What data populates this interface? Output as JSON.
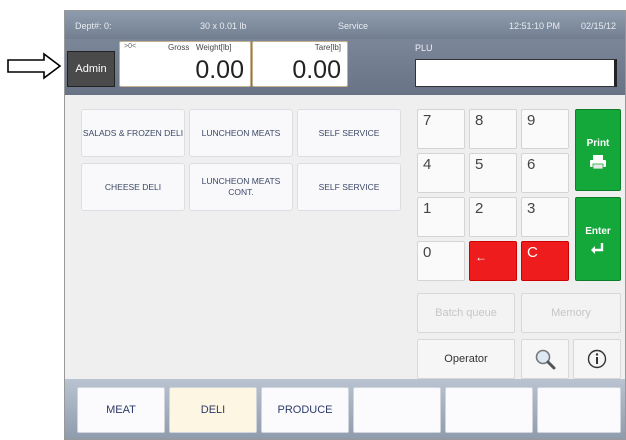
{
  "topbar": {
    "dept": "Dept#: 0:",
    "scale_spec": "30 x 0.01 lb",
    "mode": "Service",
    "time": "12:51:10 PM",
    "date": "02/15/12"
  },
  "header": {
    "admin_label": "Admin",
    "zero_indicator": ">0<",
    "gross_label": "Gross",
    "weight_label": "Weight[lb]",
    "weight_value": "0.00",
    "tare_label": "Tare[lb]",
    "tare_value": "0.00",
    "plu_label": "PLU",
    "plu_value": ""
  },
  "categories": [
    {
      "label": "SALADS & FROZEN DELI"
    },
    {
      "label": "LUNCHEON MEATS"
    },
    {
      "label": "SELF SERVICE"
    },
    {
      "label": "CHEESE DELI"
    },
    {
      "label": "LUNCHEON MEATS CONT."
    },
    {
      "label": "SELF SERVICE"
    }
  ],
  "keypad": {
    "keys": [
      "7",
      "8",
      "9",
      "4",
      "5",
      "6",
      "1",
      "2",
      "3",
      "0"
    ],
    "backspace": "←",
    "clear": "C",
    "print_label": "Print",
    "enter_label": "Enter",
    "print_icon": "printer-icon",
    "enter_icon": "enter-icon"
  },
  "functions": {
    "batch_queue": "Batch queue",
    "memory": "Memory",
    "operator": "Operator",
    "search_icon": "magnifier-icon",
    "info_icon": "info-icon"
  },
  "departments": [
    "MEAT",
    "DELI",
    "PRODUCE",
    "",
    "",
    ""
  ],
  "colors": {
    "red_key": "#ee1c1c",
    "green_key": "#14a83a",
    "header_bg": "#737f90"
  }
}
